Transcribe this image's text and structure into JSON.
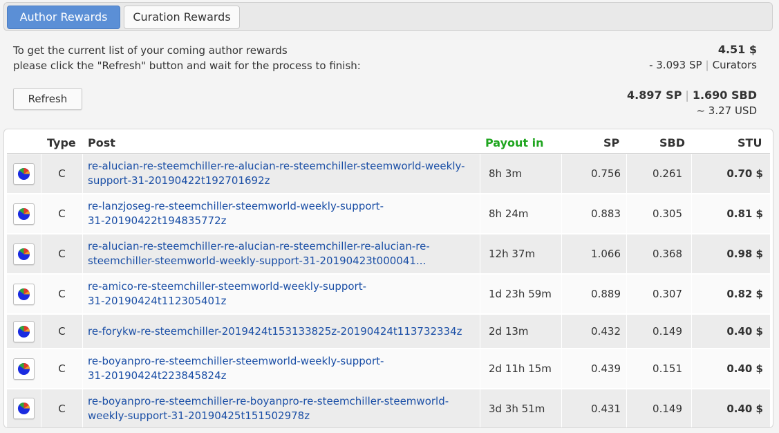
{
  "tabs": {
    "author_rewards": "Author Rewards",
    "curation_rewards": "Curation Rewards"
  },
  "intro": {
    "line1": "To get the current list of your coming author rewards",
    "line2": "please click the \"Refresh\" button and wait for the process to finish:"
  },
  "refresh_label": "Refresh",
  "summary": {
    "total_usd": "4.51 $",
    "curators_sp": "- 3.093 SP",
    "curators_label": "Curators",
    "net_sp": "4.897 SP",
    "net_sbd": "1.690 SBD",
    "approx_usd": "~ 3.27 USD"
  },
  "table": {
    "headers": {
      "type": "Type",
      "post": "Post",
      "payout": "Payout in",
      "sp": "SP",
      "sbd": "SBD",
      "stu": "STU"
    },
    "rows": [
      {
        "type": "C",
        "post_line1": "re-alucian-re-steemchiller-re-alucian-re-steemchiller-steemworld-weekly-",
        "post_line2": "support-31-20190422t192701692z",
        "payout": "8h 3m",
        "sp": "0.756",
        "sbd": "0.261",
        "stu": "0.70 $"
      },
      {
        "type": "C",
        "post_line1": "re-lanzjoseg-re-steemchiller-steemworld-weekly-support-",
        "post_line2": "31-20190422t194835772z",
        "payout": "8h 24m",
        "sp": "0.883",
        "sbd": "0.305",
        "stu": "0.81 $"
      },
      {
        "type": "C",
        "post_line1": "re-alucian-re-steemchiller-re-alucian-re-steemchiller-re-alucian-re-",
        "post_line2": "steemchiller-steemworld-weekly-support-31-20190423t000041...",
        "payout": "12h 37m",
        "sp": "1.066",
        "sbd": "0.368",
        "stu": "0.98 $"
      },
      {
        "type": "C",
        "post_line1": "re-amico-re-steemchiller-steemworld-weekly-support-",
        "post_line2": "31-20190424t112305401z",
        "payout": "1d 23h 59m",
        "sp": "0.889",
        "sbd": "0.307",
        "stu": "0.82 $"
      },
      {
        "type": "C",
        "post_line1": "re-forykw-re-steemchiller-2019424t153133825z-20190424t113732334z",
        "post_line2": "",
        "payout": "2d 13m",
        "sp": "0.432",
        "sbd": "0.149",
        "stu": "0.40 $"
      },
      {
        "type": "C",
        "post_line1": "re-boyanpro-re-steemchiller-steemworld-weekly-support-",
        "post_line2": "31-20190424t223845824z",
        "payout": "2d 11h 15m",
        "sp": "0.439",
        "sbd": "0.151",
        "stu": "0.40 $"
      },
      {
        "type": "C",
        "post_line1": "re-boyanpro-re-steemchiller-re-boyanpro-re-steemchiller-steemworld-",
        "post_line2": "weekly-support-31-20190425t151502978z",
        "payout": "3d 3h 51m",
        "sp": "0.431",
        "sbd": "0.149",
        "stu": "0.40 $"
      }
    ]
  },
  "icons": {
    "row_action": "pie-chart-icon"
  },
  "colors": {
    "accent": "#5b8fd6",
    "link": "#1b4fa6",
    "payout_header": "#1fa51f",
    "pie_blue": "#1a2be0",
    "pie_green": "#2fa83a",
    "pie_red": "#e03a2a",
    "pie_orange": "#f0a020"
  }
}
